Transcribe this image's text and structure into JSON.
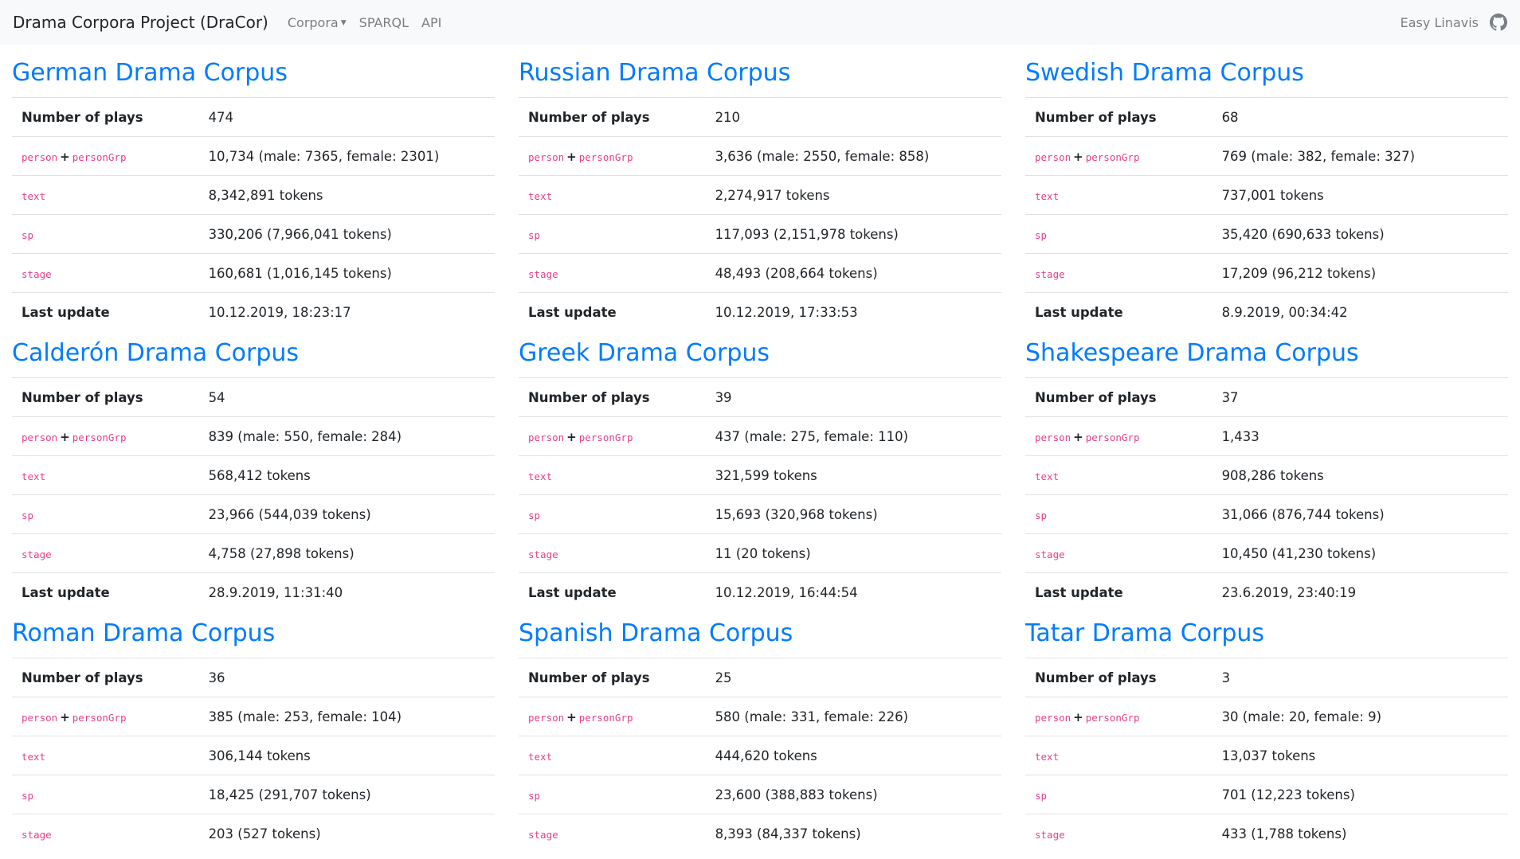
{
  "navbar": {
    "brand": "Drama Corpora Project (DraCor)",
    "links": [
      {
        "label": "Corpora",
        "dropdown": true
      },
      {
        "label": "SPARQL"
      },
      {
        "label": "API"
      }
    ],
    "right_link": "Easy Linavis",
    "right_icon": "github-icon"
  },
  "labels": {
    "plays": "Number of plays",
    "person": "person",
    "plus": "+",
    "personGrp": "personGrp",
    "text": "text",
    "sp": "sp",
    "stage": "stage",
    "update": "Last update"
  },
  "corpora": [
    {
      "title": "German Drama Corpus",
      "plays": "474",
      "persons": "10,734 (male: 7365, female: 2301)",
      "text": "8,342,891 tokens",
      "sp": "330,206 (7,966,041 tokens)",
      "stage": "160,681 (1,016,145 tokens)",
      "updated": "10.12.2019, 18:23:17"
    },
    {
      "title": "Russian Drama Corpus",
      "plays": "210",
      "persons": "3,636 (male: 2550, female: 858)",
      "text": "2,274,917 tokens",
      "sp": "117,093 (2,151,978 tokens)",
      "stage": "48,493 (208,664 tokens)",
      "updated": "10.12.2019, 17:33:53"
    },
    {
      "title": "Swedish Drama Corpus",
      "plays": "68",
      "persons": "769 (male: 382, female: 327)",
      "text": "737,001 tokens",
      "sp": "35,420 (690,633 tokens)",
      "stage": "17,209 (96,212 tokens)",
      "updated": "8.9.2019, 00:34:42"
    },
    {
      "title": "Calderón Drama Corpus",
      "plays": "54",
      "persons": "839 (male: 550, female: 284)",
      "text": "568,412 tokens",
      "sp": "23,966 (544,039 tokens)",
      "stage": "4,758 (27,898 tokens)",
      "updated": "28.9.2019, 11:31:40"
    },
    {
      "title": "Greek Drama Corpus",
      "plays": "39",
      "persons": "437 (male: 275, female: 110)",
      "text": "321,599 tokens",
      "sp": "15,693 (320,968 tokens)",
      "stage": "11 (20 tokens)",
      "updated": "10.12.2019, 16:44:54"
    },
    {
      "title": "Shakespeare Drama Corpus",
      "plays": "37",
      "persons": "1,433",
      "text": "908,286 tokens",
      "sp": "31,066 (876,744 tokens)",
      "stage": "10,450 (41,230 tokens)",
      "updated": "23.6.2019, 23:40:19"
    },
    {
      "title": "Roman Drama Corpus",
      "plays": "36",
      "persons": "385 (male: 253, female: 104)",
      "text": "306,144 tokens",
      "sp": "18,425 (291,707 tokens)",
      "stage": "203 (527 tokens)",
      "updated": ""
    },
    {
      "title": "Spanish Drama Corpus",
      "plays": "25",
      "persons": "580 (male: 331, female: 226)",
      "text": "444,620 tokens",
      "sp": "23,600 (388,883 tokens)",
      "stage": "8,393 (84,337 tokens)",
      "updated": ""
    },
    {
      "title": "Tatar Drama Corpus",
      "plays": "3",
      "persons": "30 (male: 20, female: 9)",
      "text": "13,037 tokens",
      "sp": "701 (12,223 tokens)",
      "stage": "433 (1,788 tokens)",
      "updated": ""
    }
  ],
  "colors": {
    "link": "#007bff",
    "code": "#e83e8c",
    "navbar_bg": "#f8f9fa"
  }
}
